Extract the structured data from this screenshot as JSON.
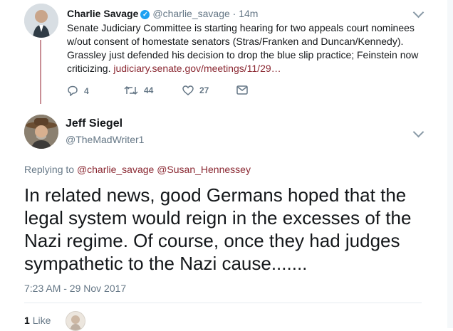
{
  "parent_tweet": {
    "author_name": "Charlie Savage",
    "handle_time": "@charlie_savage · 14m",
    "text_lines": [
      "Senate Judiciary Committee is starting hearing for two appeals court nominees",
      "w/out consent of homestate senators (Stras/Franken and Duncan/Kennedy).",
      "Grassley just defended his decision to drop the blue slip practice; Feinstein now",
      "criticizing."
    ],
    "link": "judiciary.senate.gov/meetings/11/29…",
    "actions": {
      "replies": "4",
      "retweets": "44",
      "likes": "27"
    }
  },
  "reply_tweet": {
    "author_name": "Jeff Siegel",
    "handle": "@TheMadWriter1",
    "replying_prefix": "Replying to",
    "replying_to_1": "@charlie_savage",
    "replying_to_2": "@Susan_Hennessey",
    "text": "In related news, good Germans hoped that the legal system would reign in the excesses of the Nazi regime. Of course, once they had judges sympathetic to the Nazi cause.......",
    "timestamp": "7:23 AM - 29 Nov 2017",
    "like_count": "1",
    "like_label": "Like"
  },
  "colors": {
    "link": "#8a2731",
    "secondary": "#657786",
    "verified": "#1da1f2",
    "thread_line": "#c98f96"
  },
  "icons": [
    "verified-badge-icon",
    "chevron-down-icon",
    "reply-icon",
    "retweet-icon",
    "heart-icon",
    "dm-envelope-icon"
  ]
}
